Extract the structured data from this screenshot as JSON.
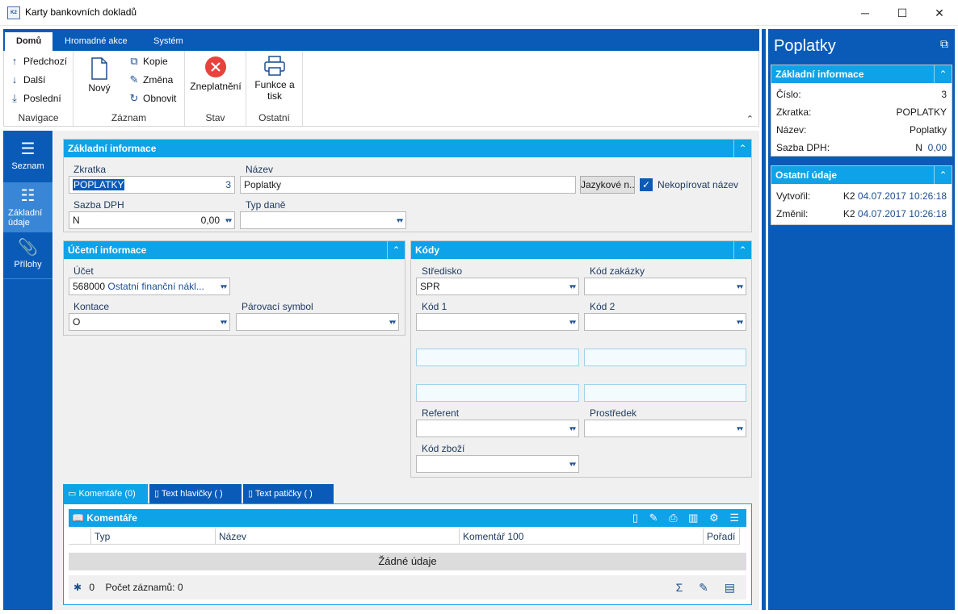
{
  "window": {
    "title": "Karty bankovních dokladů",
    "app_icon": "K2",
    "minimize": "─",
    "maximize": "☐",
    "close": "✕"
  },
  "ribbon": {
    "tabs": [
      {
        "label": "Domů"
      },
      {
        "label": "Hromadné akce"
      },
      {
        "label": "Systém"
      }
    ],
    "groups": {
      "navigace": {
        "label": "Navigace",
        "items": [
          {
            "label": "Předchozí"
          },
          {
            "label": "Další"
          },
          {
            "label": "Poslední"
          }
        ]
      },
      "zaznam": {
        "label": "Záznam",
        "novy": "Nový",
        "items": [
          {
            "label": "Kopie"
          },
          {
            "label": "Změna"
          },
          {
            "label": "Obnovit"
          }
        ]
      },
      "stav": {
        "label": "Stav",
        "zneplatneni": "Zneplatnění"
      },
      "ostatni": {
        "label": "Ostatní",
        "funkce": "Funkce a tisk"
      }
    },
    "collapse": "⌃"
  },
  "leftnav": [
    {
      "label": "Seznam"
    },
    {
      "label": "Základní údaje"
    },
    {
      "label": "Přílohy"
    }
  ],
  "zakladni": {
    "title": "Základní informace",
    "zkratka_label": "Zkratka",
    "zkratka_value": "POPLATKY",
    "zkratka_num": "3",
    "nazev_label": "Název",
    "nazev_value": "Poplatky",
    "jazykove": "Jazykové n...",
    "nekopirovat": "Nekopírovat název",
    "sazba_label": "Sazba DPH",
    "sazba_code": "N",
    "sazba_value": "0,00",
    "typdane_label": "Typ daně"
  },
  "ucetni": {
    "title": "Účetní informace",
    "ucet_label": "Účet",
    "ucet_value": "568000",
    "ucet_desc": "Ostatní finanční nákl...",
    "kontace_label": "Kontace",
    "kontace_value": "O",
    "parovaci_label": "Párovací symbol"
  },
  "kody": {
    "title": "Kódy",
    "stredisko_label": "Středisko",
    "stredisko_value": "SPR",
    "zakazka_label": "Kód zakázky",
    "kod1_label": "Kód 1",
    "kod2_label": "Kód 2",
    "referent_label": "Referent",
    "prostredek_label": "Prostředek",
    "zbozi_label": "Kód zboží"
  },
  "bottomtabs": [
    {
      "label": "Komentáře (0)"
    },
    {
      "label": "Text hlavičky ( )"
    },
    {
      "label": "Text patičky ( )"
    }
  ],
  "komentare": {
    "title": "Komentáře",
    "columns": [
      "Typ",
      "Název",
      "Komentář 100",
      "Pořadí"
    ],
    "empty": "Žádné údaje",
    "count_icon_value": "0",
    "count_text": "Počet záznamů: 0"
  },
  "rightpanel": {
    "title": "Poplatky",
    "zakladni": {
      "title": "Základní informace",
      "rows": [
        {
          "label": "Číslo:",
          "value": "3"
        },
        {
          "label": "Zkratka:",
          "value": "POPLATKY"
        },
        {
          "label": "Název:",
          "value": "Poplatky"
        }
      ],
      "sazba_label": "Sazba DPH:",
      "sazba_code": "N",
      "sazba_value": "0,00"
    },
    "ostatni": {
      "title": "Ostatní údaje",
      "rows": [
        {
          "label": "Vytvořil:",
          "user": "K2",
          "date": "04.07.2017 10:26:18"
        },
        {
          "label": "Změnil:",
          "user": "K2",
          "date": "04.07.2017 10:26:18"
        }
      ]
    }
  },
  "colors": {
    "ribbon_blue": "#0a5bb8",
    "header_cyan": "#0ea2e8",
    "link_blue": "#1e4f8f"
  }
}
